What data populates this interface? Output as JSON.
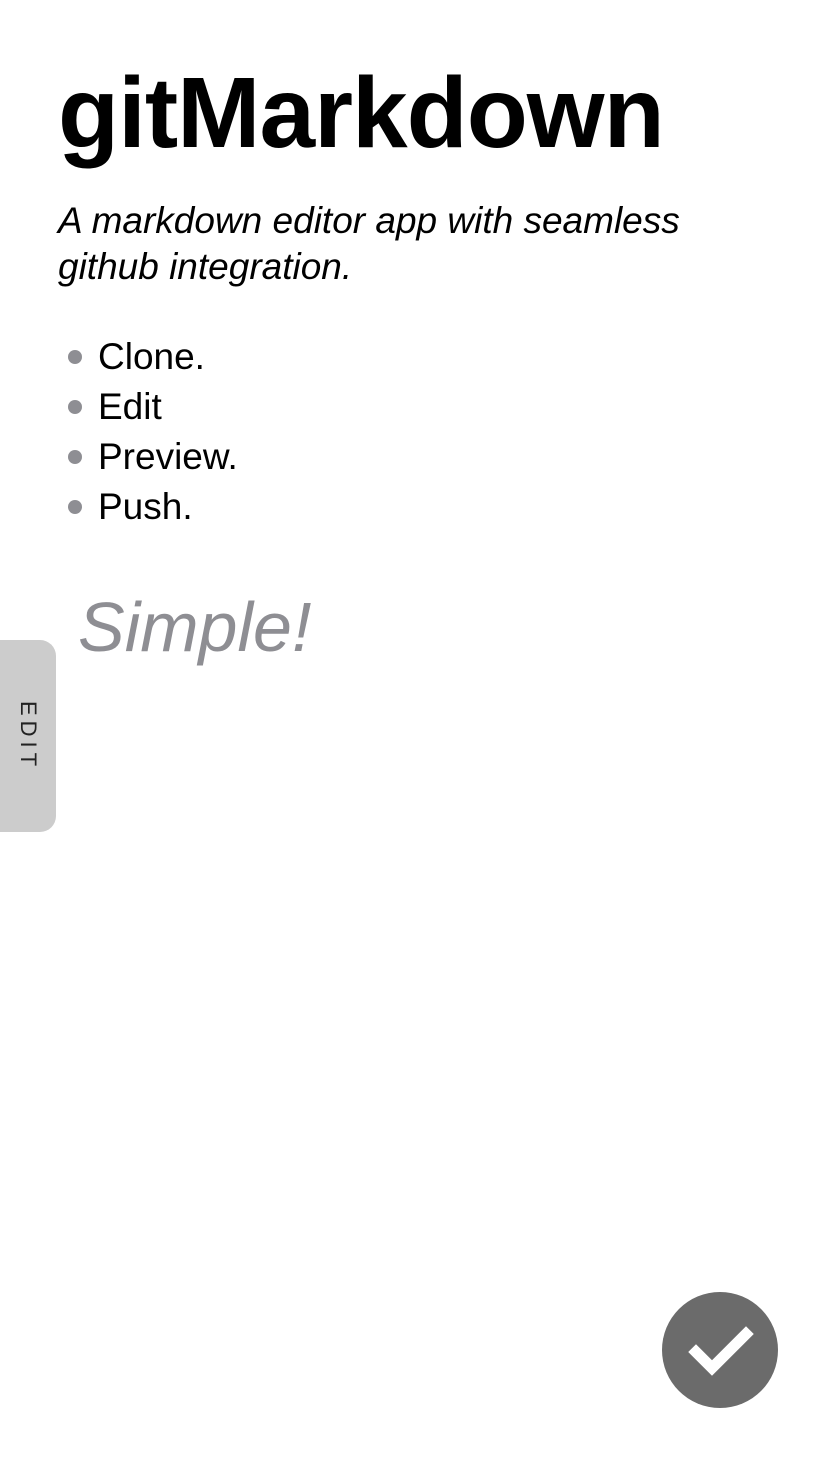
{
  "document": {
    "title": "gitMarkdown",
    "tagline": "A markdown editor app with seamless github integration.",
    "steps": [
      {
        "label": "Clone."
      },
      {
        "label": "Edit"
      },
      {
        "label": "Preview."
      },
      {
        "label": "Push."
      }
    ],
    "emphasis": "Simple!"
  },
  "edit_tab": {
    "label": "EDIT",
    "icon": "vertical-tab"
  },
  "fab": {
    "icon": "checkmark-icon"
  },
  "colors": {
    "text": "#000000",
    "bullet": "#8e8e93",
    "emphasis": "#8e8e93",
    "edit_tab_bg": "#cccccc",
    "fab_bg": "#6b6b6b",
    "fab_icon": "#ffffff"
  }
}
